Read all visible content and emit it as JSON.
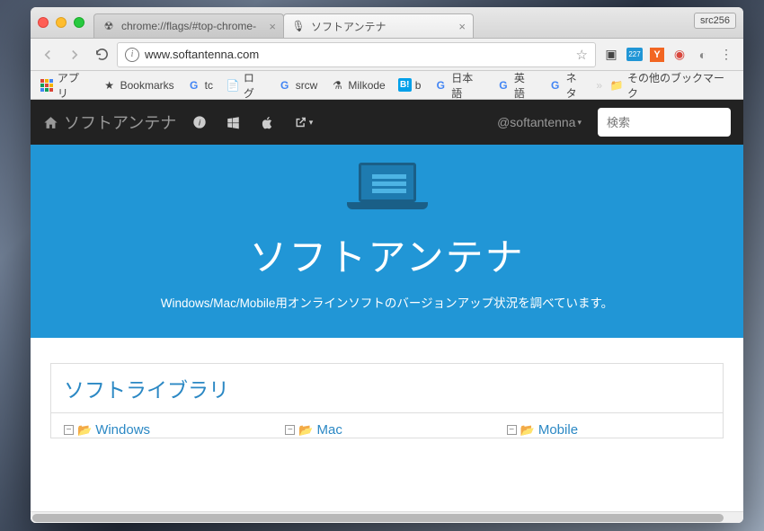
{
  "browser": {
    "profile_badge": "src256",
    "tabs": [
      {
        "title": "chrome://flags/#top-chrome-",
        "favicon": "radioactive"
      },
      {
        "title": "ソフトアンテナ",
        "favicon": "mic"
      }
    ],
    "url": "www.softantenna.com",
    "bookmarks_label": "アプリ",
    "bookmarks": [
      {
        "label": "Bookmarks",
        "icon": "star"
      },
      {
        "label": "tc",
        "icon": "g"
      },
      {
        "label": "ログ",
        "icon": "doc"
      },
      {
        "label": "srcw",
        "icon": "g"
      },
      {
        "label": "Milkode",
        "icon": "flask"
      },
      {
        "label": "b",
        "icon": "b"
      },
      {
        "label": "日本語",
        "icon": "g"
      },
      {
        "label": "英語",
        "icon": "g"
      },
      {
        "label": "ネタ",
        "icon": "g"
      }
    ],
    "other_bookmarks": "その他のブックマーク"
  },
  "site": {
    "brand": "ソフトアンテナ",
    "handle": "@softantenna",
    "search_placeholder": "検索",
    "hero_title": "ソフトアンテナ",
    "hero_subtitle": "Windows/Mac/Mobile用オンラインソフトのバージョンアップ状況を調べています。",
    "section_title": "ソフトライブラリ",
    "libs": [
      {
        "name": "Windows"
      },
      {
        "name": "Mac"
      },
      {
        "name": "Mobile"
      }
    ]
  }
}
